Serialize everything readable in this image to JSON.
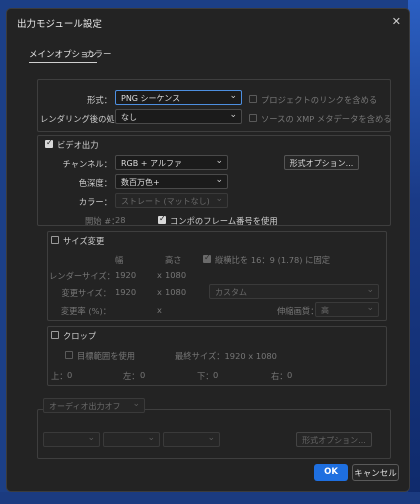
{
  "window": {
    "title": "出力モジュール設定",
    "close_icon": "close-icon"
  },
  "tabs": [
    {
      "label": "メインオプション"
    },
    {
      "label": "カラー"
    }
  ],
  "format": {
    "label": "形式：",
    "value": "PNG シーケンス",
    "postrender_label": "レンダリング後の処理：",
    "postrender_value": "なし",
    "include_link": "プロジェクトのリンクを含める",
    "include_xmp": "ソースの XMP メタデータを含める"
  },
  "video": {
    "section_label": "ビデオ出力",
    "channel_label": "チャンネル：",
    "channel_value": "RGB + アルファ",
    "depth_label": "色深度：",
    "depth_value": "数百万色+",
    "color_label": "カラー：",
    "color_value": "ストレート (マットなし)",
    "format_options": "形式オプション...",
    "start_label": "開始 #：",
    "start_value": "28",
    "use_comp_frame": "コンポのフレーム番号を使用"
  },
  "resize": {
    "section_label": "サイズ変更",
    "col_width": "幅",
    "col_height": "高さ",
    "lock_aspect": "縦横比を 16：9 (1.78) に固定",
    "render_size_label": "レンダーサイズ：",
    "render_w": "1920",
    "render_h": "1080",
    "resize_to_label": "変更サイズ：",
    "resize_w": "1920",
    "resize_h": "1080",
    "preset_value": "カスタム",
    "percent_label": "変更率 (%)：",
    "percent_x": "x",
    "quality_label": "伸縮画質：",
    "quality_value": "高",
    "x_symbol": "x"
  },
  "crop": {
    "section_label": "クロップ",
    "use_roi": "目標範囲を使用",
    "final_size": "最終サイズ：1920 x 1080",
    "top_label": "上：",
    "top_value": "0",
    "left_label": "左：",
    "left_value": "0",
    "bottom_label": "下：",
    "bottom_value": "0",
    "right_label": "右：",
    "right_value": "0"
  },
  "audio": {
    "output_value": "オーディオ出力オフ",
    "format_options": "形式オプション..."
  },
  "footer": {
    "ok": "OK",
    "cancel": "キャンセル"
  }
}
